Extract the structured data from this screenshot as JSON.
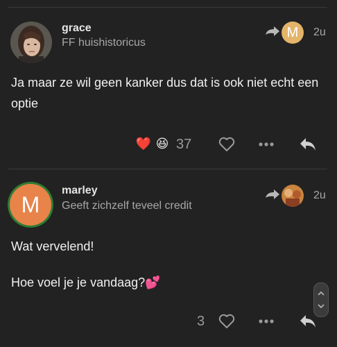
{
  "posts": [
    {
      "username": "grace",
      "user_title": "FF huishistoricus",
      "reply_to_avatar_letter": "M",
      "time": "2u",
      "body": [
        "Ja maar ze wil geen kanker dus dat is ook niet echt een optie"
      ],
      "reactions": [
        "❤️",
        "😆"
      ],
      "reaction_count": "37"
    },
    {
      "username": "marley",
      "user_title": "Geeft zichzelf teveel credit",
      "avatar_letter": "M",
      "time": "2u",
      "body": [
        "Wat vervelend!",
        "Hoe voel je je vandaag?💕"
      ],
      "like_count": "3"
    }
  ],
  "colors": {
    "background": "#222222",
    "avatar_orange": "#e8834a",
    "avatar_ring_green": "#2e7d32",
    "small_avatar_tan": "#e3b46a"
  },
  "icons": [
    "reply-arrow-icon",
    "heart-outline-icon",
    "more-dots-icon",
    "reply-icon",
    "chevron-up-icon",
    "chevron-down-icon"
  ]
}
